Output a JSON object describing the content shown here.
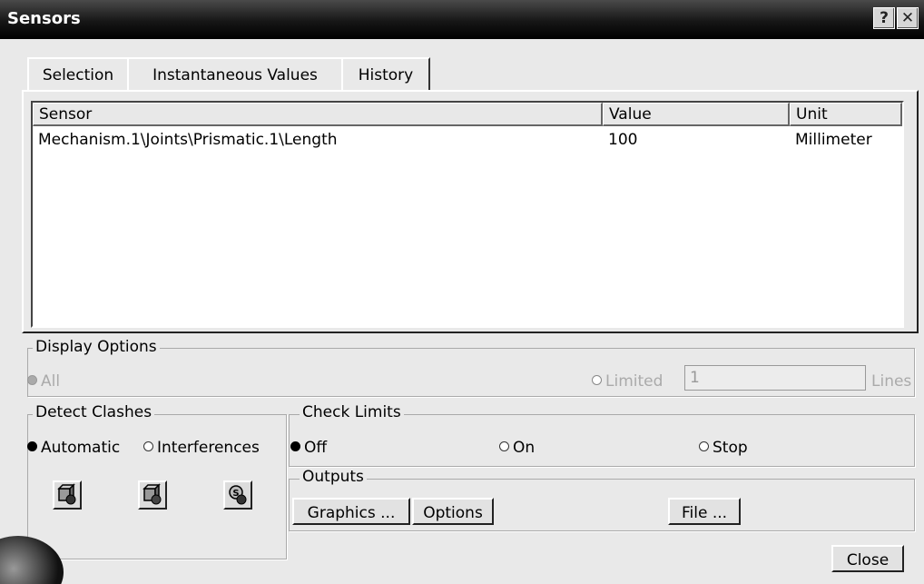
{
  "window": {
    "title": "Sensors",
    "help_icon": "help-icon",
    "close_icon": "close-icon"
  },
  "tabs": [
    {
      "label": "Selection"
    },
    {
      "label": "Instantaneous Values"
    },
    {
      "label": "History"
    }
  ],
  "table": {
    "headers": [
      "Sensor",
      "Value",
      "Unit"
    ],
    "rows": [
      {
        "sensor": "Mechanism.1\\Joints\\Prismatic.1\\Length",
        "value": "100",
        "unit": "Millimeter"
      }
    ]
  },
  "display_options": {
    "label": "Display Options",
    "all_label": "All",
    "limited_label": "Limited",
    "lines_value": "1",
    "lines_label": "Lines",
    "selected": "All"
  },
  "detect_clashes": {
    "label": "Detect Clashes",
    "automatic_label": "Automatic",
    "interferences_label": "Interferences",
    "selected": "Automatic",
    "icons": [
      "clash-check-icon",
      "clash-stop-icon",
      "clash-stop-alt-icon"
    ]
  },
  "check_limits": {
    "label": "Check Limits",
    "off_label": "Off",
    "on_label": "On",
    "stop_label": "Stop",
    "selected": "Off"
  },
  "outputs": {
    "label": "Outputs",
    "graphics_label": "Graphics ...",
    "options_label": "Options",
    "file_label": "File ..."
  },
  "footer": {
    "close_label": "Close"
  }
}
